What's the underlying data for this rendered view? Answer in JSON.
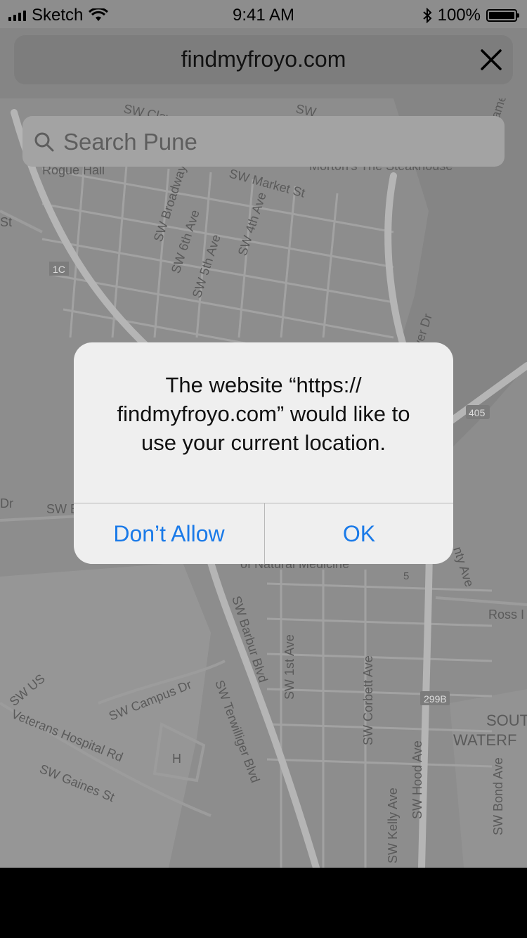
{
  "status_bar": {
    "carrier": "Sketch",
    "time": "9:41 AM",
    "battery_percent": "100%",
    "battery_level": 1.0,
    "icons": [
      "signal-icon",
      "wifi-icon",
      "bluetooth-icon",
      "battery-icon"
    ]
  },
  "browser": {
    "url": "findmyfroyo.com",
    "close_icon": "close-icon"
  },
  "search": {
    "placeholder": "Search Pune",
    "icon": "search-icon"
  },
  "map": {
    "streets": [
      "SW Clay",
      "SW",
      "SW Market St",
      "SW Broadway",
      "SW 6th Ave",
      "SW 5th Ave",
      "SW 4th Ave",
      "Rogue Hall",
      "Morton's The Steakhouse",
      "St",
      "1C",
      "ver Dr",
      "405",
      "Dr",
      "SW B",
      "of Natural Medicine",
      "nty Ave",
      "5",
      "Ross I",
      "SW Barbur Blvd",
      "SW 1st Ave",
      "SW Corbett Ave",
      "SW Campus Dr",
      "SW Terwilliger Blvd",
      "SW US Veterans Hospital Rd",
      "SW Gaines St",
      "H",
      "299B",
      "SOUT",
      "WATERF",
      "SW Hood Ave",
      "SW Kelly Ave",
      "SW Bond Ave",
      "ame"
    ]
  },
  "dialog": {
    "message": "The website “https:// findmyfroyo.com” would like to use your current location.",
    "deny_label": "Don’t Allow",
    "ok_label": "OK"
  },
  "colors": {
    "accent": "#1a7ae8",
    "overlay": "#8e8e8e"
  }
}
